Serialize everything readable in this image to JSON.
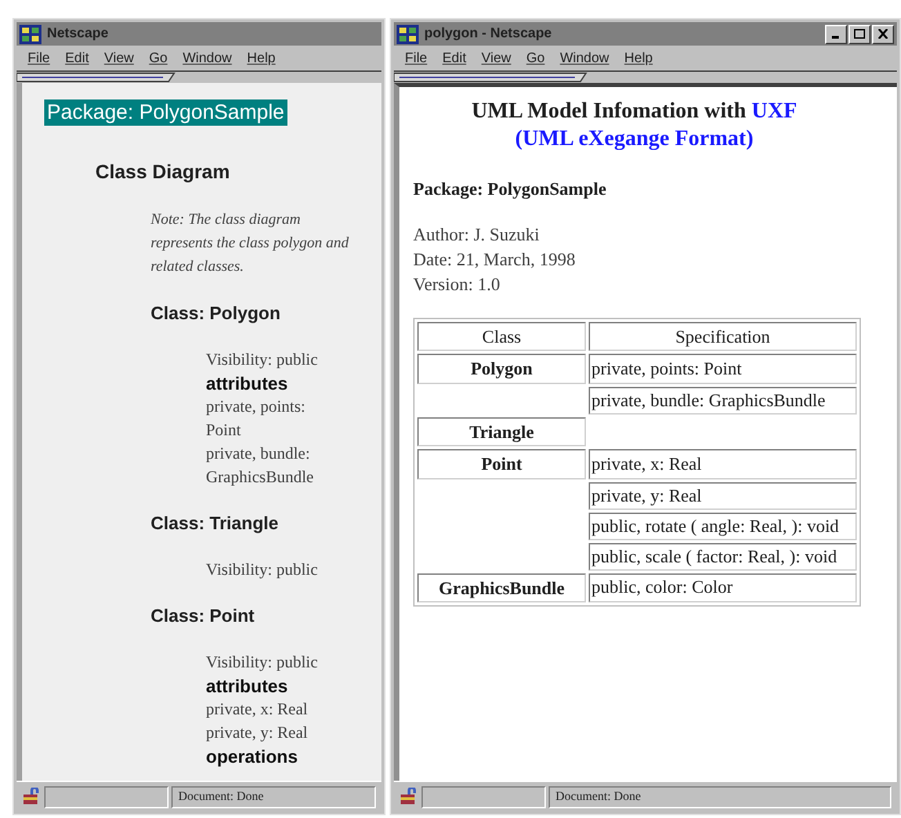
{
  "left_window": {
    "title": "Netscape",
    "menu": [
      "File",
      "Edit",
      "View",
      "Go",
      "Window",
      "Help"
    ],
    "package": "Package: PolygonSample",
    "heading": "Class Diagram",
    "note": "Note: The class diagram represents the class polygon and related classes.",
    "classes": [
      {
        "title": "Class: Polygon",
        "lines": [
          {
            "kind": "text",
            "text": "Visibility: public"
          },
          {
            "kind": "section",
            "text": "attributes"
          },
          {
            "kind": "text",
            "text": "private, points:"
          },
          {
            "kind": "text",
            "text": "Point"
          },
          {
            "kind": "text",
            "text": "private, bundle:"
          },
          {
            "kind": "text",
            "text": "GraphicsBundle"
          }
        ]
      },
      {
        "title": "Class: Triangle",
        "lines": [
          {
            "kind": "text",
            "text": "Visibility: public"
          }
        ]
      },
      {
        "title": "Class: Point",
        "lines": [
          {
            "kind": "text",
            "text": "Visibility: public"
          },
          {
            "kind": "section",
            "text": "attributes"
          },
          {
            "kind": "text",
            "text": "private, x: Real"
          },
          {
            "kind": "text",
            "text": "private, y: Real"
          },
          {
            "kind": "section",
            "text": "operations"
          }
        ]
      }
    ],
    "status": "Document: Done"
  },
  "right_window": {
    "title": "polygon - Netscape",
    "menu": [
      "File",
      "Edit",
      "View",
      "Go",
      "Window",
      "Help"
    ],
    "heading": {
      "text": "UML Model Infomation with",
      "link": "UXF",
      "subtitle": "(UML eXegange Format)"
    },
    "package": "Package: PolygonSample",
    "info": [
      "Author: J. Suzuki",
      "Date: 21, March, 1998",
      "Version: 1.0"
    ],
    "table": {
      "columns": [
        "Class",
        "Specification"
      ],
      "rows": [
        {
          "class": "Polygon",
          "spec": "private, points: Point"
        },
        {
          "spec": "private, bundle: GraphicsBundle"
        },
        {
          "class": "Triangle"
        },
        {
          "class": "Point",
          "spec": "private, x: Real"
        },
        {
          "spec": "private, y: Real"
        },
        {
          "spec": "public, rotate ( angle: Real, ): void"
        },
        {
          "spec": "public, scale ( factor: Real, ): void"
        },
        {
          "class": "GraphicsBundle",
          "spec": "public, color: Color"
        }
      ]
    },
    "status": "Document: Done"
  }
}
